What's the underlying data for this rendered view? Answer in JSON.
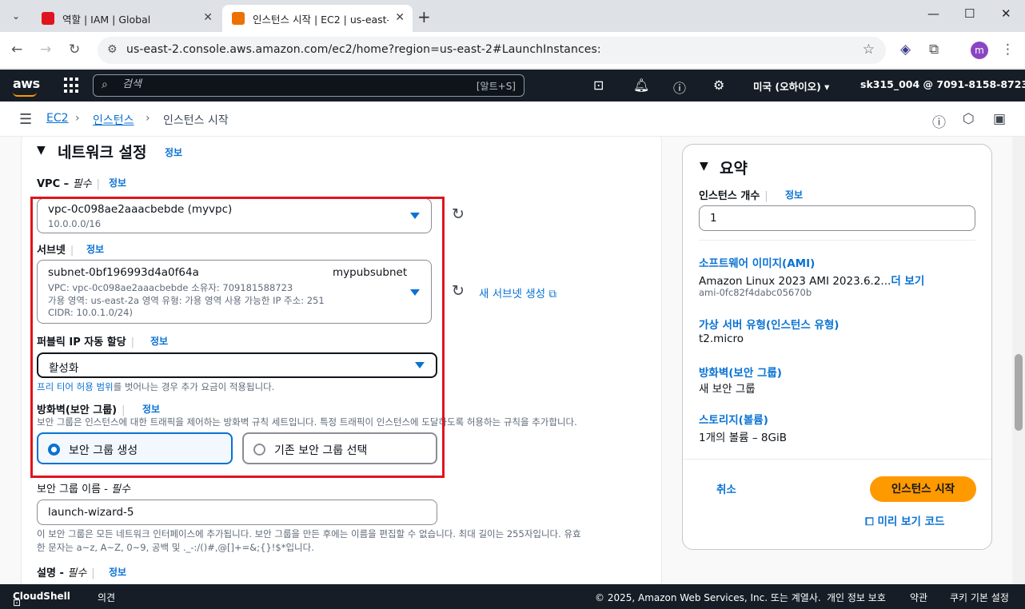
{
  "browser": {
    "tabs": [
      {
        "title": "역할 | IAM | Global",
        "active": false,
        "favicon_color": "#e0141e"
      },
      {
        "title": "인스턴스 시작 | EC2 | us-east-2",
        "active": true,
        "favicon_color": "#ed7100"
      }
    ],
    "url": "us-east-2.console.aws.amazon.com/ec2/home?region=us-east-2#LaunchInstances:",
    "profile_initial": "m"
  },
  "awsnav": {
    "logo": "aws",
    "search_placeholder": "검색",
    "search_shortcut": "[알트+S]",
    "region": "미국 (오하이오) ▾",
    "account": "sk315_004 @ 7091-8158-8723 ▾"
  },
  "breadcrumb": {
    "items": [
      "EC2",
      "인스턴스",
      "인스턴스 시작"
    ]
  },
  "network": {
    "title": "네트워크 설정",
    "info": "정보",
    "vpc": {
      "label": "VPC –",
      "required": "필수",
      "info": "정보",
      "value": "vpc-0c098ae2aaacbebde (myvpc)",
      "cidr": "10.0.0.0/16"
    },
    "subnet": {
      "label": "서브넷",
      "info": "정보",
      "id": "subnet-0bf196993d4a0f64a",
      "name": "mypubsubnet",
      "line1": "VPC: vpc-0c098ae2aaacbebde     소유자: 709181588723",
      "line2": "가용 영역: us-east-2a     영역 유형: 가용 영역     사용 가능한 IP 주소: 251",
      "line3": "CIDR: 10.0.1.0/24)",
      "new_link": "새 서브넷 생성"
    },
    "public_ip": {
      "label": "퍼블릭 IP 자동 할당",
      "info": "정보",
      "value": "활성화",
      "note_link": "프리 티어 허용 범위",
      "note_rest": "를 벗어나는 경우 추가 요금이 적용됩니다."
    },
    "firewall": {
      "label": "방화벽(보안 그룹)",
      "info": "정보",
      "desc": "보안 그룹은 인스턴스에 대한 트래픽을 제어하는 방화벽 규칙 세트입니다. 특정 트래픽이 인스턴스에 도달하도록 허용하는 규칙을 추가합니다.",
      "opt_create": "보안 그룹 생성",
      "opt_existing": "기존 보안 그룹 선택"
    },
    "sg_name": {
      "label": "보안 그룹 이름 -",
      "required": "필수",
      "value": "launch-wizard-5",
      "help1": "이 보안 그룹은 모든 네트워크 인터페이스에 추가됩니다. 보안 그룹을 만든 후에는 이름을 편집할 수 없습니다. 최대 길이는 255자입니다. 유효",
      "help2": "한 문자는 a~z, A~Z, 0~9, 공백 및 ._-:/()#,@[]+=&;{}!$*입니다."
    },
    "description": {
      "label": "설명 -",
      "required": "필수",
      "info": "정보"
    }
  },
  "summary": {
    "title": "요약",
    "count_label": "인스턴스 개수",
    "count_info": "정보",
    "count_value": "1",
    "ami_label": "소프트웨어 이미지(AMI)",
    "ami_value": "Amazon Linux 2023 AMI 2023.6.2...",
    "ami_more": "더 보기",
    "ami_id": "ami-0fc82f4dabc05670b",
    "type_label": "가상 서버 유형(인스턴스 유형)",
    "type_value": "t2.micro",
    "fw_label": "방화벽(보안 그룹)",
    "fw_value": "새 보안 그룹",
    "storage_label": "스토리지(볼륨)",
    "storage_value": "1개의 볼륨 – 8GiB",
    "cancel": "취소",
    "launch": "인스턴스 시작",
    "preview": "미리 보기 코드"
  },
  "footer": {
    "cloudshell": "CloudShell",
    "feedback": "의견",
    "copyright": "© 2025, Amazon Web Services, Inc. 또는 계열사.",
    "privacy": "개인 정보 보호",
    "terms": "약관",
    "cookies": "쿠키 기본 설정"
  }
}
